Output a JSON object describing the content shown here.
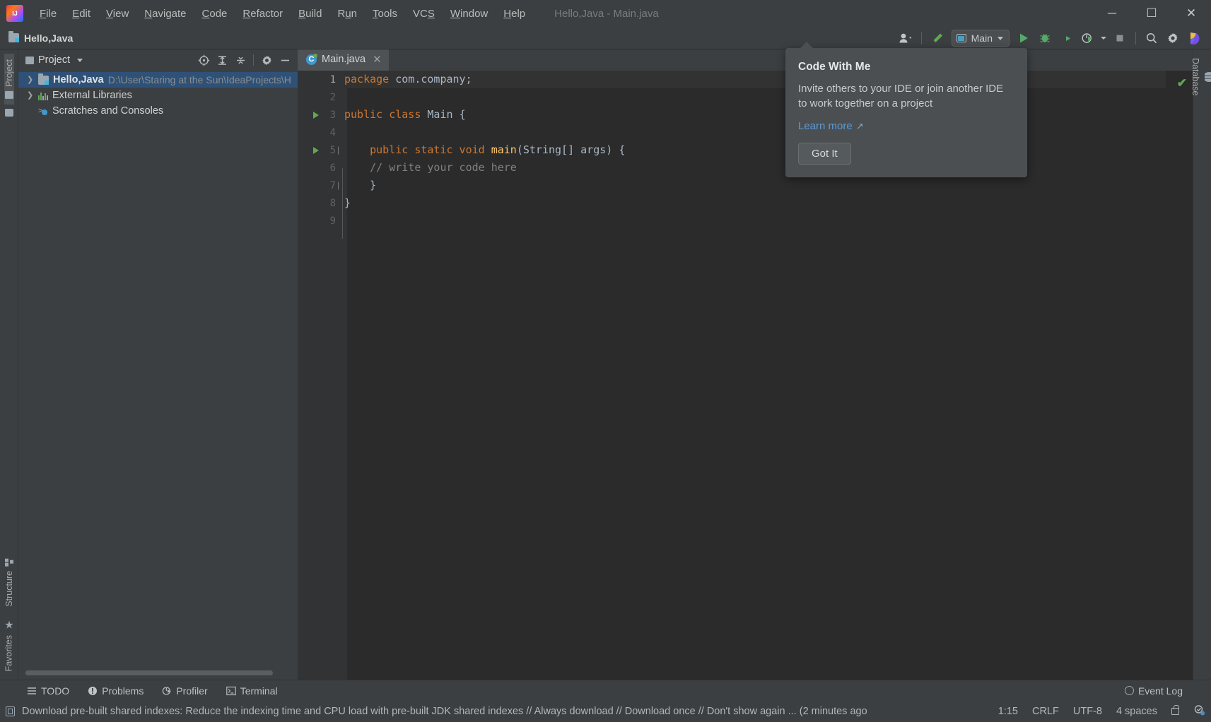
{
  "window": {
    "title": "Hello,Java - Main.java",
    "minimize_label": "─",
    "maximize_label": "☐",
    "close_label": "✕"
  },
  "menu": {
    "items": [
      {
        "label": "File",
        "mnemonic": "F"
      },
      {
        "label": "Edit",
        "mnemonic": "E"
      },
      {
        "label": "View",
        "mnemonic": "V"
      },
      {
        "label": "Navigate",
        "mnemonic": "N"
      },
      {
        "label": "Code",
        "mnemonic": "C"
      },
      {
        "label": "Refactor",
        "mnemonic": "R"
      },
      {
        "label": "Build",
        "mnemonic": "B"
      },
      {
        "label": "Run",
        "mnemonic": "u"
      },
      {
        "label": "Tools",
        "mnemonic": "T"
      },
      {
        "label": "VCS",
        "mnemonic": "S"
      },
      {
        "label": "Window",
        "mnemonic": "W"
      },
      {
        "label": "Help",
        "mnemonic": "H"
      }
    ]
  },
  "navbar": {
    "breadcrumb": "Hello,Java",
    "run_config": "Main",
    "icons": {
      "code_with_me": "people-icon",
      "build": "hammer-icon",
      "run": "run-icon",
      "debug": "debug-icon",
      "run_coverage": "run-with-coverage-icon",
      "profiler": "profiler-icon",
      "stop": "stop-icon",
      "search": "search-icon",
      "settings": "gear-icon",
      "ide_assistant": "ide-feature-icon"
    }
  },
  "left_strip": {
    "top": [
      {
        "label": "Project",
        "icon": "project-icon",
        "active": true
      },
      {
        "label": "",
        "icon": "folder-icon",
        "active": false
      }
    ],
    "bottom": [
      {
        "label": "Structure",
        "icon": "structure-icon"
      },
      {
        "label": "Favorites",
        "icon": "star-icon"
      }
    ]
  },
  "right_strip": {
    "items": [
      {
        "label": "Database",
        "icon": "database-icon"
      }
    ]
  },
  "project_panel": {
    "title": "Project",
    "tools": [
      {
        "name": "select-opened-file-icon",
        "glyph": "⊕"
      },
      {
        "name": "expand-all-icon",
        "glyph": "⤒"
      },
      {
        "name": "collapse-all-icon",
        "glyph": "⤓"
      },
      {
        "name": "settings-gear-icon",
        "glyph": "⚙"
      },
      {
        "name": "hide-panel-icon",
        "glyph": "─"
      }
    ],
    "tree": [
      {
        "label": "Hello,Java",
        "path": "D:\\User\\Staring at the Sun\\IdeaProjects\\H",
        "icon": "project-folder-icon",
        "arrow": "❯",
        "selected": true,
        "bold": true
      },
      {
        "label": "External Libraries",
        "path": "",
        "icon": "libraries-icon",
        "arrow": "❯",
        "selected": false,
        "bold": false
      },
      {
        "label": "Scratches and Consoles",
        "path": "",
        "icon": "scratches-icon",
        "arrow": "",
        "selected": false,
        "bold": false
      }
    ]
  },
  "editor": {
    "tab": {
      "label": "Main.java",
      "icon": "java-class-icon",
      "close": "✕"
    },
    "inspection_status": "✔",
    "lines": [
      {
        "n": "1",
        "runnable": false,
        "fold": "",
        "highlight": true,
        "tokens": [
          {
            "t": "package ",
            "c": "kw"
          },
          {
            "t": "com.company;",
            "c": "plain"
          }
        ]
      },
      {
        "n": "2",
        "runnable": false,
        "fold": "",
        "highlight": false,
        "tokens": []
      },
      {
        "n": "3",
        "runnable": true,
        "fold": "",
        "highlight": false,
        "tokens": [
          {
            "t": "public class ",
            "c": "kw"
          },
          {
            "t": "Main ",
            "c": "cls"
          },
          {
            "t": "{",
            "c": "plain"
          }
        ]
      },
      {
        "n": "4",
        "runnable": false,
        "fold": "",
        "highlight": false,
        "tokens": []
      },
      {
        "n": "5",
        "runnable": true,
        "fold": "−",
        "highlight": false,
        "tokens": [
          {
            "t": "    public static void ",
            "c": "kw"
          },
          {
            "t": "main",
            "c": "fn"
          },
          {
            "t": "(String[] args) {",
            "c": "plain"
          }
        ]
      },
      {
        "n": "6",
        "runnable": false,
        "fold": "",
        "highlight": false,
        "tokens": [
          {
            "t": "    // write your code here",
            "c": "cm"
          }
        ]
      },
      {
        "n": "7",
        "runnable": false,
        "fold": "⌂",
        "highlight": false,
        "tokens": [
          {
            "t": "    }",
            "c": "plain"
          }
        ]
      },
      {
        "n": "8",
        "runnable": false,
        "fold": "",
        "highlight": false,
        "tokens": [
          {
            "t": "}",
            "c": "plain"
          }
        ]
      },
      {
        "n": "9",
        "runnable": false,
        "fold": "",
        "highlight": false,
        "tokens": []
      }
    ]
  },
  "popup": {
    "title": "Code With Me",
    "body": "Invite others to your IDE or join another IDE to work together on a project",
    "link": "Learn more",
    "link_arrow": "↗",
    "button": "Got It"
  },
  "bottom_bar": {
    "buttons": [
      {
        "label": "TODO",
        "icon": "todo-list-icon",
        "glyph": "☰"
      },
      {
        "label": "Problems",
        "icon": "problems-icon",
        "glyph": "❗"
      },
      {
        "label": "Profiler",
        "icon": "profiler-icon",
        "glyph": "◔"
      },
      {
        "label": "Terminal",
        "icon": "terminal-icon",
        "glyph": "▸"
      }
    ],
    "event_log": "Event Log"
  },
  "status_bar": {
    "message": "Download pre-built shared indexes: Reduce the indexing time and CPU load with pre-built JDK shared indexes // Always download // Download once // Don't show again ... (2 minutes ago",
    "caret_position": "1:15",
    "line_separator": "CRLF",
    "encoding": "UTF-8",
    "indent": "4 spaces",
    "lock_icon": "lock-icon",
    "inspection_icon": "inspection-widget-icon"
  },
  "colors": {
    "window_bg": "#3c3f41",
    "editor_bg": "#2b2b2b",
    "gutter_bg": "#313335",
    "tab_active": "#4e5254",
    "selection": "#2f5177",
    "keyword": "#cc7832",
    "comment": "#808080",
    "function": "#ffc66d",
    "text": "#a9b7c6",
    "accent_green": "#62a850",
    "link_blue": "#5a9bd8"
  }
}
